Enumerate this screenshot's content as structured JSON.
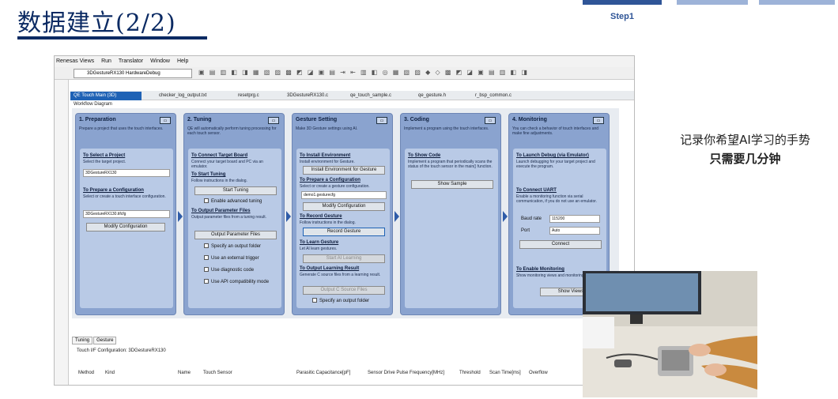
{
  "slide": {
    "title": "数据建立(2/2)",
    "step_label": "Step1",
    "caption_line1": "记录你希望AI学习的手势",
    "caption_line2": "只需要几分钟"
  },
  "ide": {
    "menu": [
      "Renesas Views",
      "Run",
      "Translator",
      "Window",
      "Help"
    ],
    "target_select": "3DGestureRX130 HardwareDebug",
    "tabs": [
      "QE Touch Main (3D)",
      "checker_log_output.txt",
      "resetprg.c",
      "3DGestureRX130.c",
      "qe_touch_sample.c",
      "qe_gesture.h",
      "r_bsp_common.c"
    ],
    "workflow_label": "Workflow Diagram",
    "panels": [
      {
        "head": "1. Preparation",
        "desc": "Prepare a project that uses the touch interfaces.",
        "sections": [
          {
            "title": "To Select a Project",
            "desc": "Select the target project."
          },
          {
            "title": "To Prepare a Configuration",
            "desc": "Select or create a touch interface configuration."
          }
        ],
        "project_select": "3DGestureRX130",
        "config_select": "3DGestureRX130.tifcfg",
        "modify_button": "Modify Configuration"
      },
      {
        "head": "2. Tuning",
        "desc": "QE will automatically perform tuning processing for each touch sensor.",
        "sections": [
          {
            "title": "To Connect Target Board",
            "desc": "Connect your target board and PC via an emulator."
          },
          {
            "title": "To Start Tuning",
            "desc": "Follow instructions in the dialog."
          },
          {
            "title": "To Output Parameter Files",
            "desc": "Output parameter files from a tuning result."
          }
        ],
        "start_button": "Start Tuning",
        "advanced_check": "Enable advanced tuning",
        "output_button": "Output Parameter Files",
        "checks": [
          "Specify an output folder",
          "Use an external trigger",
          "Use diagnostic code",
          "Use API compatibility mode"
        ]
      },
      {
        "head": "Gesture Setting",
        "desc": "Make 3D Gesture settings using AI.",
        "sections": [
          {
            "title": "To Install Environment",
            "desc": "Install environment for Gesture."
          },
          {
            "title": "To Prepare a Configuration",
            "desc": "Select or create a gesture configuration."
          },
          {
            "title": "To Record Gesture",
            "desc": "Follow instructions in the dialog."
          },
          {
            "title": "To Learn Gesture",
            "desc": "Let AI learn gestures."
          },
          {
            "title": "To Output Learning Result",
            "desc": "Generate C source files from a learning result."
          }
        ],
        "install_button": "Install Environment for Gesture",
        "config_select": "demo1.gesturecfg",
        "modify_button": "Modify Configuration",
        "record_button": "Record Gesture",
        "learn_button": "Start AI Learning",
        "output_button": "Output C Source Files",
        "specify_check": "Specify an output folder"
      },
      {
        "head": "3. Coding",
        "desc": "Implement a program using the touch interfaces.",
        "sections": [
          {
            "title": "To Show Code",
            "desc": "Implement a program that periodically scans the status of the touch sensor in the main() function."
          }
        ],
        "show_button": "Show Sample"
      },
      {
        "head": "4. Monitoring",
        "desc": "You can check a behavior of touch interfaces and make fine adjustments.",
        "sections": [
          {
            "title": "To Launch Debug (via Emulator)",
            "desc": "Launch debugging for your target project and execute the program."
          },
          {
            "title": "To Connect UART",
            "desc": "Enable a monitoring function via serial communication, if you do not use an emulator."
          },
          {
            "title": "To Enable Monitoring",
            "desc": "Show monitoring views and monitoring function."
          }
        ],
        "baud_label": "Baud rate",
        "baud_value": "115200",
        "port_label": "Port",
        "port_value": "Auto",
        "connect_button": "Connect",
        "views_button": "Show Views"
      }
    ],
    "bottom_tabs": [
      "Tuning",
      "Gesture"
    ],
    "bottom_config": "Touch I/F Configuration: 3DGestureRX130",
    "columns": [
      "Method",
      "Kind",
      "Name",
      "Touch Sensor",
      "Parasitic Capacitance[pF]",
      "Sensor Drive Pulse Frequency[MHz]",
      "Threshold",
      "Scan Time[ms]",
      "Overflow"
    ]
  }
}
